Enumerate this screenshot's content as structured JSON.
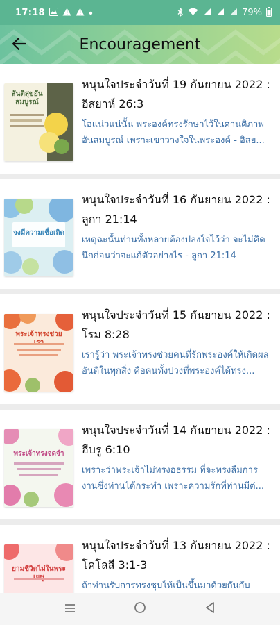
{
  "status_bar": {
    "time": "17:18",
    "left_icons": [
      "image-icon",
      "warning-icon",
      "warning-icon",
      "dot-icon"
    ],
    "right_icons": [
      "bluetooth-icon",
      "wifi-icon",
      "signal-icon",
      "signal-icon",
      "signal-icon"
    ],
    "battery": "79%"
  },
  "app_bar": {
    "title": "Encouragement",
    "back_icon": "arrow-back-icon"
  },
  "items": [
    {
      "title": "หนุนใจประจำวันที่ 19 กันยายน 2022 : อิสยาห์ 26:3",
      "desc": "โอแน่วแน่นั้น พระองค์ทรงรักษาไว้ในศานติภาพอันสมบูรณ์ เพราะเขาวางใจในพระองค์ - อิสย...",
      "thumb_text": "สันติสุขอันสมบูรณ์",
      "thumb_bg": "#6b6b52",
      "thumb_accent": "#f0c84a"
    },
    {
      "title": "หนุนใจประจำวันที่ 16 กันยายน 2022 : ลูกา 21:14",
      "desc": "เหตุฉะนั้นท่านทั้งหลายต้องปลงใจไว้ว่า จะไม่คิดนึกก่อนว่าจะแก้ตัวอย่างไร - ลูกา 21:14",
      "thumb_text": "จงมีความเชื่อเถิด",
      "thumb_bg": "#d9eef0",
      "thumb_accent": "#6ba8d6"
    },
    {
      "title": "หนุนใจประจำวันที่ 15 กันยายน 2022 : โรม 8:28",
      "desc": "เรารู้ว่า พระเจ้าทรงช่วยคนที่รักพระองค์ให้เกิดผลอันดีในทุกสิ่ง คือคนทั้งปวงที่พระองค์ได้ทรง...",
      "thumb_text": "พระเจ้าทรงช่วยเรา",
      "thumb_bg": "#fbe8d8",
      "thumb_accent": "#e2603a"
    },
    {
      "title": "หนุนใจประจำวันที่ 14 กันยายน 2022 : ฮีบรู 6:10",
      "desc": "เพราะว่าพระเจ้าไม่ทรงอธรรม ที่จะทรงลืมการงานซึ่งท่านได้กระทำ เพราะความรักที่ท่านมีต่...",
      "thumb_text": "พระเจ้าทรงจดจำ",
      "thumb_bg": "#f3f6ee",
      "thumb_accent": "#d96aa0"
    },
    {
      "title": "หนุนใจประจำวันที่ 13 กันยายน 2022 : โคโลสี 3:1-3",
      "desc": "ถ้าท่านรับการทรงชุบให้เป็นขึ้นมาด้วยกันกับ",
      "thumb_text": "ยามชีวิตไม่ในพระเยซู",
      "thumb_bg": "#fde4e4",
      "thumb_accent": "#e05050"
    }
  ],
  "nav_bar": {
    "icons": [
      "recents-icon",
      "home-icon",
      "back-icon"
    ]
  }
}
